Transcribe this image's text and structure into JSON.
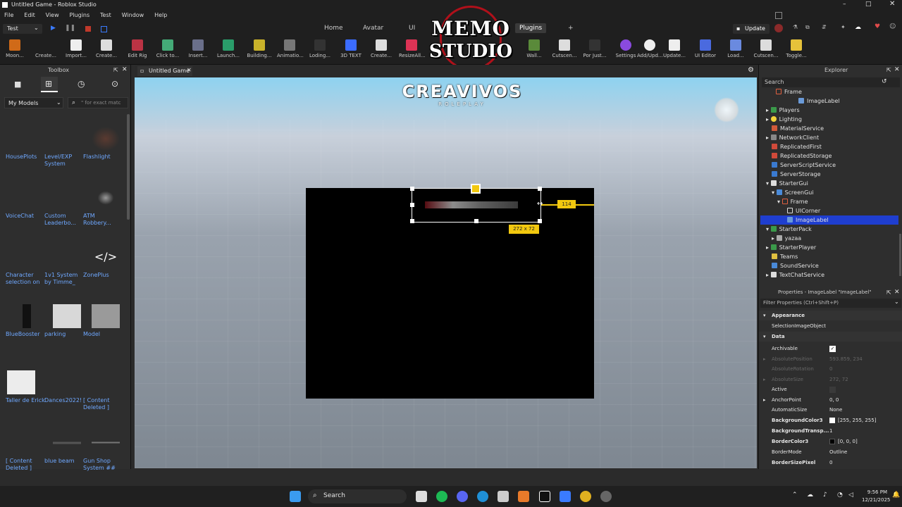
{
  "window": {
    "title": "Untitled Game - Roblox Studio"
  },
  "menu": [
    "File",
    "Edit",
    "View",
    "Plugins",
    "Test",
    "Window",
    "Help"
  ],
  "mode_select": "Test",
  "ribbon_tabs": [
    "Home",
    "Avatar",
    "UI",
    "Plugins"
  ],
  "ribbon_tools": [
    "Moon...",
    "Create...",
    "Import...",
    "Create...",
    "Edit Rig",
    "Click to...",
    "Insert...",
    "Launch...",
    "Building...",
    "Animatio...",
    "Loding...",
    "3D TEXT",
    "Create...",
    "ResizeAll...",
    "Wall...",
    "Cutscen...",
    "Por Just...",
    "Settings",
    "Add/Upd...",
    "Update...",
    "UI Editor",
    "Load...",
    "Cutscen...",
    "Toggle..."
  ],
  "update_label": "Update",
  "watermark": {
    "line1": "MEMO",
    "line2": "STUDIO"
  },
  "toolbox": {
    "title": "Toolbox",
    "category": "My Models",
    "search_placeholder": "\" for exact matc",
    "items": [
      "HousePlots",
      "Level/EXP System",
      "Flashlight",
      "VoiceChat",
      "Custom Leaderbo...",
      "ATM Robbery...",
      "Character selection on",
      "1v1 System by Timme_",
      "ZonePlus",
      "BlueBooster",
      "parking",
      "Model",
      "Taller de Erick",
      "Dances2022!",
      "[ Content Deleted ]",
      "[ Content Deleted ]",
      "blue beam",
      "Gun Shop System ##"
    ]
  },
  "viewport": {
    "tab": "Untitled Game",
    "logo_main": "CREAVIVOS",
    "logo_sub": "ROLEPLAY",
    "size_label": "272 x 72",
    "drag_label": "114"
  },
  "explorer": {
    "title": "Explorer",
    "search_placeholder": "Search",
    "items": [
      "Frame",
      "ImageLabel",
      "Players",
      "Lighting",
      "MaterialService",
      "NetworkClient",
      "ReplicatedFirst",
      "ReplicatedStorage",
      "ServerScriptService",
      "ServerStorage",
      "StarterGui",
      "ScreenGui",
      "Frame",
      "UICorner",
      "ImageLabel",
      "StarterPack",
      "yazaa",
      "StarterPlayer",
      "Teams",
      "SoundService",
      "TextChatService"
    ]
  },
  "properties": {
    "title": "Properties - ImageLabel \"ImageLabel\"",
    "filter": "Filter Properties (Ctrl+Shift+P)",
    "sections": [
      "Appearance",
      "Data"
    ],
    "appearance_row": "SelectionImageObject",
    "rows": [
      {
        "name": "Archivable",
        "value": ""
      },
      {
        "name": "AbsolutePosition",
        "value": "593.859, 234"
      },
      {
        "name": "AbsoluteRotation",
        "value": "0"
      },
      {
        "name": "AbsoluteSize",
        "value": "272, 72"
      },
      {
        "name": "Active",
        "value": ""
      },
      {
        "name": "AnchorPoint",
        "value": "0, 0"
      },
      {
        "name": "AutomaticSize",
        "value": "None"
      },
      {
        "name": "BackgroundColor3",
        "value": "[255, 255, 255]"
      },
      {
        "name": "BackgroundTransp...",
        "value": "1"
      },
      {
        "name": "BorderColor3",
        "value": "[0, 0, 0]"
      },
      {
        "name": "BorderMode",
        "value": "Outline"
      },
      {
        "name": "BorderSizePixel",
        "value": "0"
      }
    ]
  },
  "taskbar": {
    "search": "Search",
    "time": "9:56 PM",
    "date": "12/21/2025"
  }
}
